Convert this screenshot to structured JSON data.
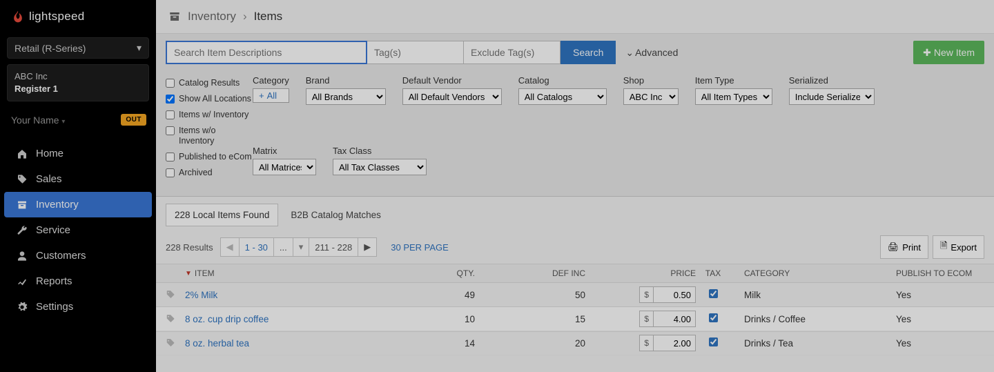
{
  "logo": {
    "text": "lightspeed"
  },
  "retail_selector": "Retail (R-Series)",
  "company": {
    "name": "ABC Inc",
    "register": "Register 1"
  },
  "user": {
    "name": "Your Name",
    "badge": "OUT"
  },
  "nav": {
    "home": "Home",
    "sales": "Sales",
    "inventory": "Inventory",
    "service": "Service",
    "customers": "Customers",
    "reports": "Reports",
    "settings": "Settings"
  },
  "breadcrumb": {
    "parent": "Inventory",
    "current": "Items"
  },
  "search": {
    "placeholder": "Search Item Descriptions",
    "tags_placeholder": "Tag(s)",
    "exclude_placeholder": "Exclude Tag(s)",
    "button": "Search",
    "advanced": "Advanced",
    "new_item": "New Item"
  },
  "checks": {
    "catalog_results": "Catalog Results",
    "show_all_locations": "Show All Locations",
    "items_w_inventory": "Items w/ Inventory",
    "items_wo_inventory": "Items w/o Inventory",
    "published_ecom": "Published to eCom",
    "archived": "Archived"
  },
  "filters": {
    "category_label": "Category",
    "add_all": "All",
    "brand_label": "Brand",
    "brand_value": "All Brands",
    "vendor_label": "Default Vendor",
    "vendor_value": "All Default Vendors",
    "catalog_label": "Catalog",
    "catalog_value": "All Catalogs",
    "shop_label": "Shop",
    "shop_value": "ABC Inc",
    "item_type_label": "Item Type",
    "item_type_value": "All Item Types",
    "serialized_label": "Serialized",
    "serialized_value": "Include Serialized",
    "matrix_label": "Matrix",
    "matrix_value": "All Matrices",
    "taxclass_label": "Tax Class",
    "taxclass_value": "All Tax Classes"
  },
  "tabs": {
    "local": "228 Local Items Found",
    "b2b": "B2B Catalog Matches"
  },
  "results": {
    "count": "228 Results",
    "range1": "1 - 30",
    "dots": "...",
    "range2": "211 - 228",
    "per_page": "30 PER PAGE",
    "print": "Print",
    "export": "Export"
  },
  "columns": {
    "item": "ITEM",
    "qty": "QTY.",
    "definc": "DEF INC",
    "price": "PRICE",
    "tax": "TAX",
    "category": "CATEGORY",
    "publish": "PUBLISH TO ECOM"
  },
  "rows": [
    {
      "name": "2% Milk",
      "qty": "49",
      "definc": "50",
      "currency": "$",
      "price": "0.50",
      "tax": true,
      "category": "Milk",
      "publish": "Yes"
    },
    {
      "name": "8 oz. cup drip coffee",
      "qty": "10",
      "definc": "15",
      "currency": "$",
      "price": "4.00",
      "tax": true,
      "category": "Drinks / Coffee",
      "publish": "Yes"
    },
    {
      "name": "8 oz. herbal tea",
      "qty": "14",
      "definc": "20",
      "currency": "$",
      "price": "2.00",
      "tax": true,
      "category": "Drinks / Tea",
      "publish": "Yes"
    }
  ]
}
